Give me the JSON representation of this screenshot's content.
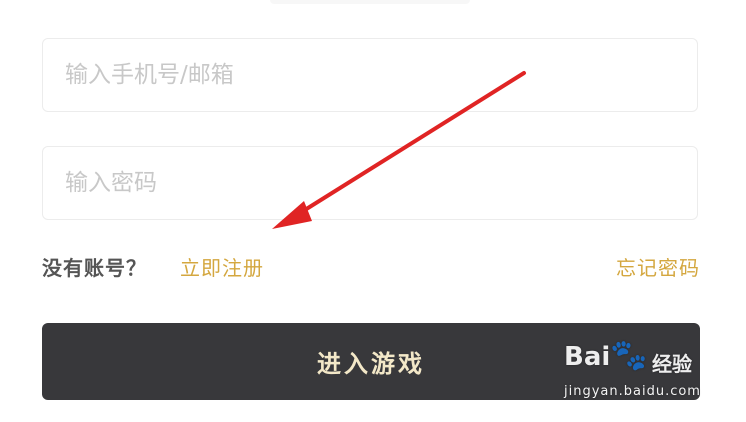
{
  "form": {
    "phone_placeholder": "输入手机号/邮箱",
    "password_placeholder": "输入密码",
    "phone_value": "",
    "password_value": ""
  },
  "links": {
    "no_account_text": "没有账号？",
    "register_label": "立即注册",
    "forgot_password_label": "忘记密码"
  },
  "actions": {
    "enter_game_label": "进入游戏"
  },
  "watermark": {
    "brand": "Bai",
    "brand_suffix": "经验",
    "url": "jingyan.baidu.com"
  },
  "colors": {
    "accent_gold": "#d4a73f",
    "button_bg": "#38383b",
    "annotation_arrow": "#e02424"
  },
  "icons": {
    "watermark_paw": "paw-icon",
    "annotation": "red-arrow-icon"
  }
}
